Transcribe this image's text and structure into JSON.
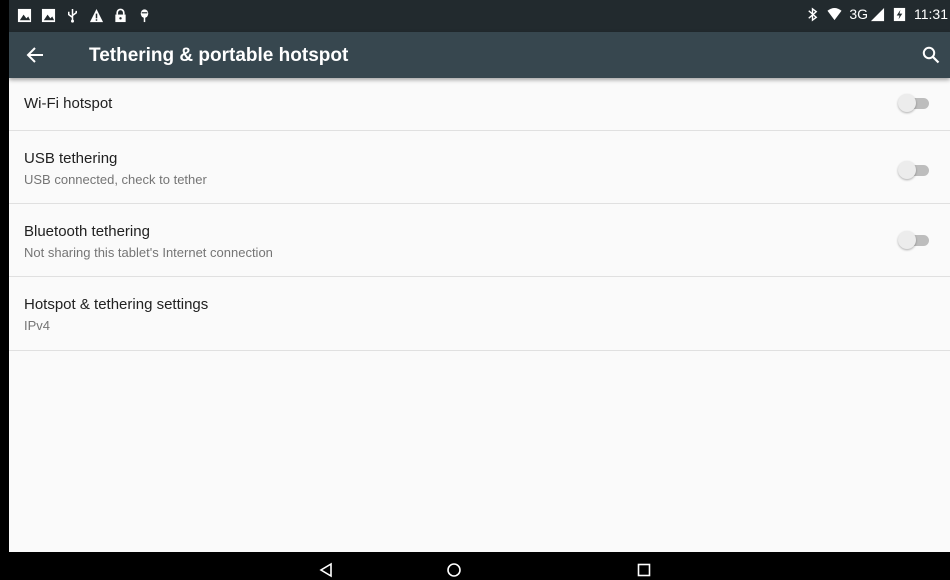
{
  "status_bar": {
    "time": "11:31",
    "network": "3G",
    "left_icons": [
      "image-notification-icon",
      "image-notification-icon",
      "usb-icon",
      "warning-icon",
      "lock-icon",
      "debug-icon"
    ],
    "right_icons": [
      "bluetooth-icon",
      "wifi-icon",
      "signal-icon",
      "battery-icon"
    ]
  },
  "toolbar": {
    "title": "Tethering & portable hotspot",
    "back_icon": "arrow-back-icon",
    "search_icon": "search-icon"
  },
  "list": {
    "items": [
      {
        "title": "Wi-Fi hotspot",
        "subtitle": "",
        "toggle": true,
        "checked": false
      },
      {
        "title": "USB tethering",
        "subtitle": "USB connected, check to tether",
        "toggle": true,
        "checked": false
      },
      {
        "title": "Bluetooth tethering",
        "subtitle": "Not sharing this tablet's Internet connection",
        "toggle": true,
        "checked": false
      },
      {
        "title": "Hotspot & tethering settings",
        "subtitle": "IPv4",
        "toggle": false
      }
    ]
  },
  "nav_bar": {
    "buttons": [
      "back-nav-icon",
      "home-nav-icon",
      "recents-nav-icon"
    ]
  },
  "colors": {
    "status_bar_bg": "#222a2e",
    "toolbar_bg": "#37474f",
    "content_bg": "#fafafa",
    "divider": "#e0e0e0"
  }
}
